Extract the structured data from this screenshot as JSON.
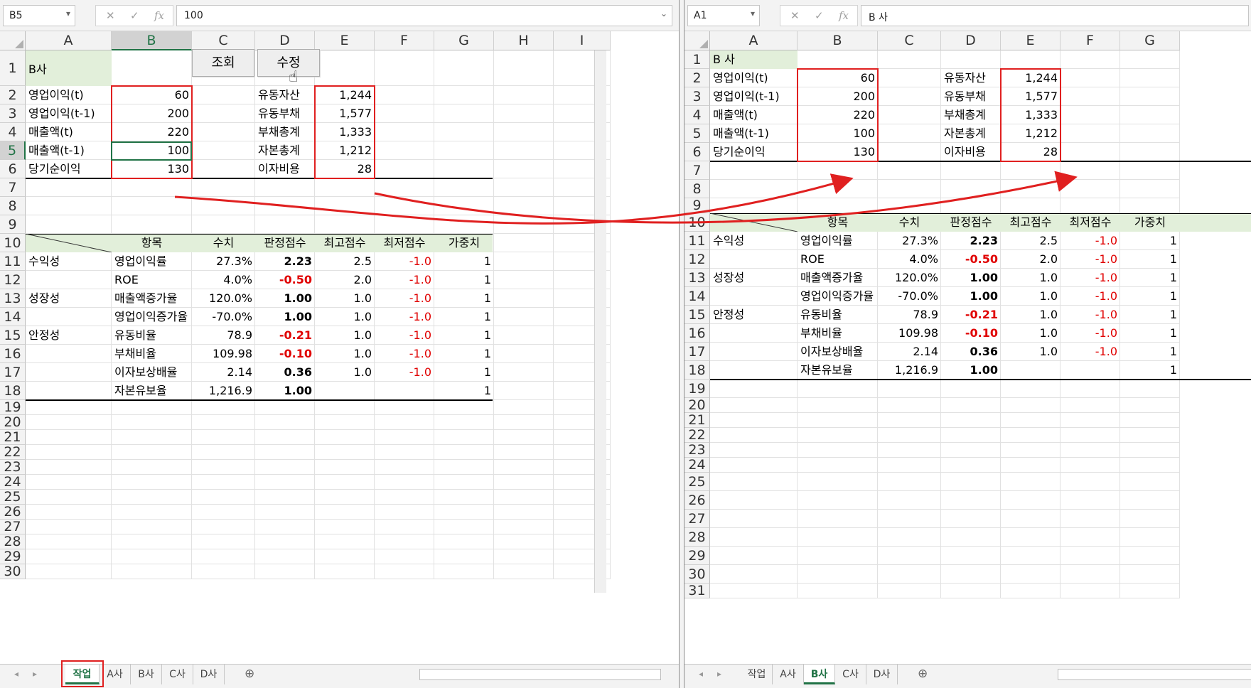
{
  "left": {
    "namebox": "B5",
    "formula": "100",
    "columns": [
      "A",
      "B",
      "C",
      "D",
      "E",
      "F",
      "G",
      "H",
      "I"
    ],
    "rows": [
      "1",
      "2",
      "3",
      "4",
      "5",
      "6",
      "7",
      "8",
      "9",
      "10",
      "11",
      "12",
      "13",
      "14",
      "15",
      "16",
      "17",
      "18",
      "19",
      "20",
      "21",
      "22",
      "23",
      "24",
      "25",
      "26",
      "27",
      "28",
      "29",
      "30"
    ],
    "company": "B사",
    "button_query": "조회",
    "button_edit": "수정",
    "labels_a": [
      "영업이익(t)",
      "영업이익(t-1)",
      "매출액(t)",
      "매출액(t-1)",
      "당기순이익"
    ],
    "values_b": [
      "60",
      "200",
      "220",
      "100",
      "130"
    ],
    "labels_d": [
      "유동자산",
      "유동부채",
      "부채총계",
      "자본총계",
      "이자비용"
    ],
    "values_e": [
      "1,244",
      "1,577",
      "1,333",
      "1,212",
      "28"
    ],
    "table_headers": [
      "항목",
      "수치",
      "판정점수",
      "최고점수",
      "최저점수",
      "가중치"
    ],
    "groups": [
      "수익성",
      "성장성",
      "안정성"
    ],
    "items": [
      "영업이익률",
      "ROE",
      "매출액증가율",
      "영업이익증가율",
      "유동비율",
      "부채비율",
      "이자보상배율",
      "자본유보율"
    ],
    "values": [
      "27.3%",
      "4.0%",
      "120.0%",
      "-70.0%",
      "78.9",
      "109.98",
      "2.14",
      "1,216.9"
    ],
    "scores": [
      "2.23",
      "-0.50",
      "1.00",
      "1.00",
      "-0.21",
      "-0.10",
      "0.36",
      "1.00"
    ],
    "max_scores": [
      "2.5",
      "2.0",
      "1.0",
      "1.0",
      "1.0",
      "1.0",
      "1.0",
      ""
    ],
    "min_scores": [
      "-1.0",
      "-1.0",
      "-1.0",
      "-1.0",
      "-1.0",
      "-1.0",
      "-1.0",
      ""
    ],
    "weights": [
      "1",
      "1",
      "1",
      "1",
      "1",
      "1",
      "1",
      "1"
    ],
    "tabs": [
      "작업",
      "A사",
      "B사",
      "C사",
      "D사"
    ],
    "active_tab": "작업"
  },
  "right": {
    "namebox": "A1",
    "formula": "B 사",
    "columns": [
      "A",
      "B",
      "C",
      "D",
      "E",
      "F",
      "G"
    ],
    "rows": [
      "1",
      "2",
      "3",
      "4",
      "5",
      "6",
      "7",
      "8",
      "9",
      "10",
      "11",
      "12",
      "13",
      "14",
      "15",
      "16",
      "17",
      "18",
      "19",
      "20",
      "21",
      "22",
      "23",
      "24",
      "25",
      "26",
      "27",
      "28",
      "29",
      "30",
      "31"
    ],
    "company": "B 사",
    "labels_a": [
      "영업이익(t)",
      "영업이익(t-1)",
      "매출액(t)",
      "매출액(t-1)",
      "당기순이익"
    ],
    "values_b": [
      "60",
      "200",
      "220",
      "100",
      "130"
    ],
    "labels_d": [
      "유동자산",
      "유동부채",
      "부채총계",
      "자본총계",
      "이자비용"
    ],
    "values_e": [
      "1,244",
      "1,577",
      "1,333",
      "1,212",
      "28"
    ],
    "table_headers": [
      "항목",
      "수치",
      "판정점수",
      "최고점수",
      "최저점수",
      "가중치"
    ],
    "groups": [
      "수익성",
      "성장성",
      "안정성"
    ],
    "items": [
      "영업이익률",
      "ROE",
      "매출액증가율",
      "영업이익증가율",
      "유동비율",
      "부채비율",
      "이자보상배율",
      "자본유보율"
    ],
    "values": [
      "27.3%",
      "4.0%",
      "120.0%",
      "-70.0%",
      "78.9",
      "109.98",
      "2.14",
      "1,216.9"
    ],
    "scores": [
      "2.23",
      "-0.50",
      "1.00",
      "1.00",
      "-0.21",
      "-0.10",
      "0.36",
      "1.00"
    ],
    "max_scores": [
      "2.5",
      "2.0",
      "1.0",
      "1.0",
      "1.0",
      "1.0",
      "1.0",
      ""
    ],
    "min_scores": [
      "-1.0",
      "-1.0",
      "-1.0",
      "-1.0",
      "-1.0",
      "-1.0",
      "-1.0",
      ""
    ],
    "weights": [
      "1",
      "1",
      "1",
      "1",
      "1",
      "1",
      "1",
      "1"
    ],
    "tabs": [
      "작업",
      "A사",
      "B사",
      "C사",
      "D사"
    ],
    "active_tab": "B사"
  },
  "colors": {
    "accent": "#217346",
    "header_fill": "#e2efda",
    "highlight_red": "#e02020",
    "negative": "#e00000"
  },
  "icons": [
    "cancel-icon",
    "enter-icon",
    "function-icon",
    "dropdown-icon",
    "add-sheet-icon",
    "scroll-left-icon",
    "scroll-right-icon",
    "mouse-cursor-icon"
  ]
}
